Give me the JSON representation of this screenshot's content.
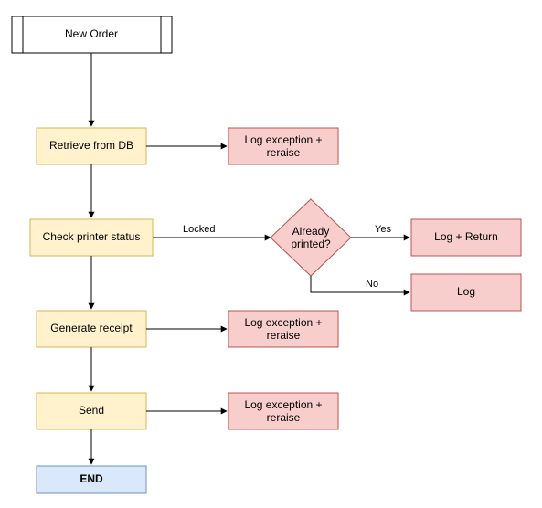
{
  "chart_data": {
    "type": "flowchart",
    "title": "",
    "nodes": [
      {
        "id": "start",
        "label": "New Order",
        "type": "process",
        "style": "white-subbox"
      },
      {
        "id": "retrieve",
        "label": "Retrieve from DB",
        "type": "process",
        "style": "yellow"
      },
      {
        "id": "retrieve_err",
        "label": "Log exception + reraise",
        "type": "process",
        "style": "red"
      },
      {
        "id": "check",
        "label": "Check printer status",
        "type": "process",
        "style": "yellow"
      },
      {
        "id": "printed_q",
        "label": "Already printed?",
        "type": "decision",
        "style": "red"
      },
      {
        "id": "log_return",
        "label": "Log + Return",
        "type": "process",
        "style": "red"
      },
      {
        "id": "log",
        "label": "Log",
        "type": "process",
        "style": "red"
      },
      {
        "id": "gen",
        "label": "Generate receipt",
        "type": "process",
        "style": "yellow"
      },
      {
        "id": "gen_err",
        "label": "Log exception + reraise",
        "type": "process",
        "style": "red"
      },
      {
        "id": "send",
        "label": "Send",
        "type": "process",
        "style": "yellow"
      },
      {
        "id": "send_err",
        "label": "Log exception + reraise",
        "type": "process",
        "style": "red"
      },
      {
        "id": "end",
        "label": "END",
        "type": "terminator",
        "style": "blue"
      }
    ],
    "edges": [
      {
        "from": "start",
        "to": "retrieve",
        "label": ""
      },
      {
        "from": "retrieve",
        "to": "retrieve_err",
        "label": ""
      },
      {
        "from": "retrieve",
        "to": "check",
        "label": ""
      },
      {
        "from": "check",
        "to": "printed_q",
        "label": "Locked"
      },
      {
        "from": "printed_q",
        "to": "log_return",
        "label": "Yes"
      },
      {
        "from": "printed_q",
        "to": "log",
        "label": "No"
      },
      {
        "from": "check",
        "to": "gen",
        "label": ""
      },
      {
        "from": "gen",
        "to": "gen_err",
        "label": ""
      },
      {
        "from": "gen",
        "to": "send",
        "label": ""
      },
      {
        "from": "send",
        "to": "send_err",
        "label": ""
      },
      {
        "from": "send",
        "to": "end",
        "label": ""
      }
    ]
  },
  "nodes": {
    "start": "New Order",
    "retrieve": "Retrieve from DB",
    "retrieve_err1": "Log exception +",
    "retrieve_err2": "reraise",
    "check": "Check printer status",
    "printed_q1": "Already",
    "printed_q2": "printed?",
    "log_return": "Log + Return",
    "log": "Log",
    "gen": "Generate receipt",
    "gen_err1": "Log exception +",
    "gen_err2": "reraise",
    "send": "Send",
    "send_err1": "Log exception +",
    "send_err2": "reraise",
    "end": "END"
  },
  "edge_labels": {
    "locked": "Locked",
    "yes": "Yes",
    "no": "No"
  }
}
